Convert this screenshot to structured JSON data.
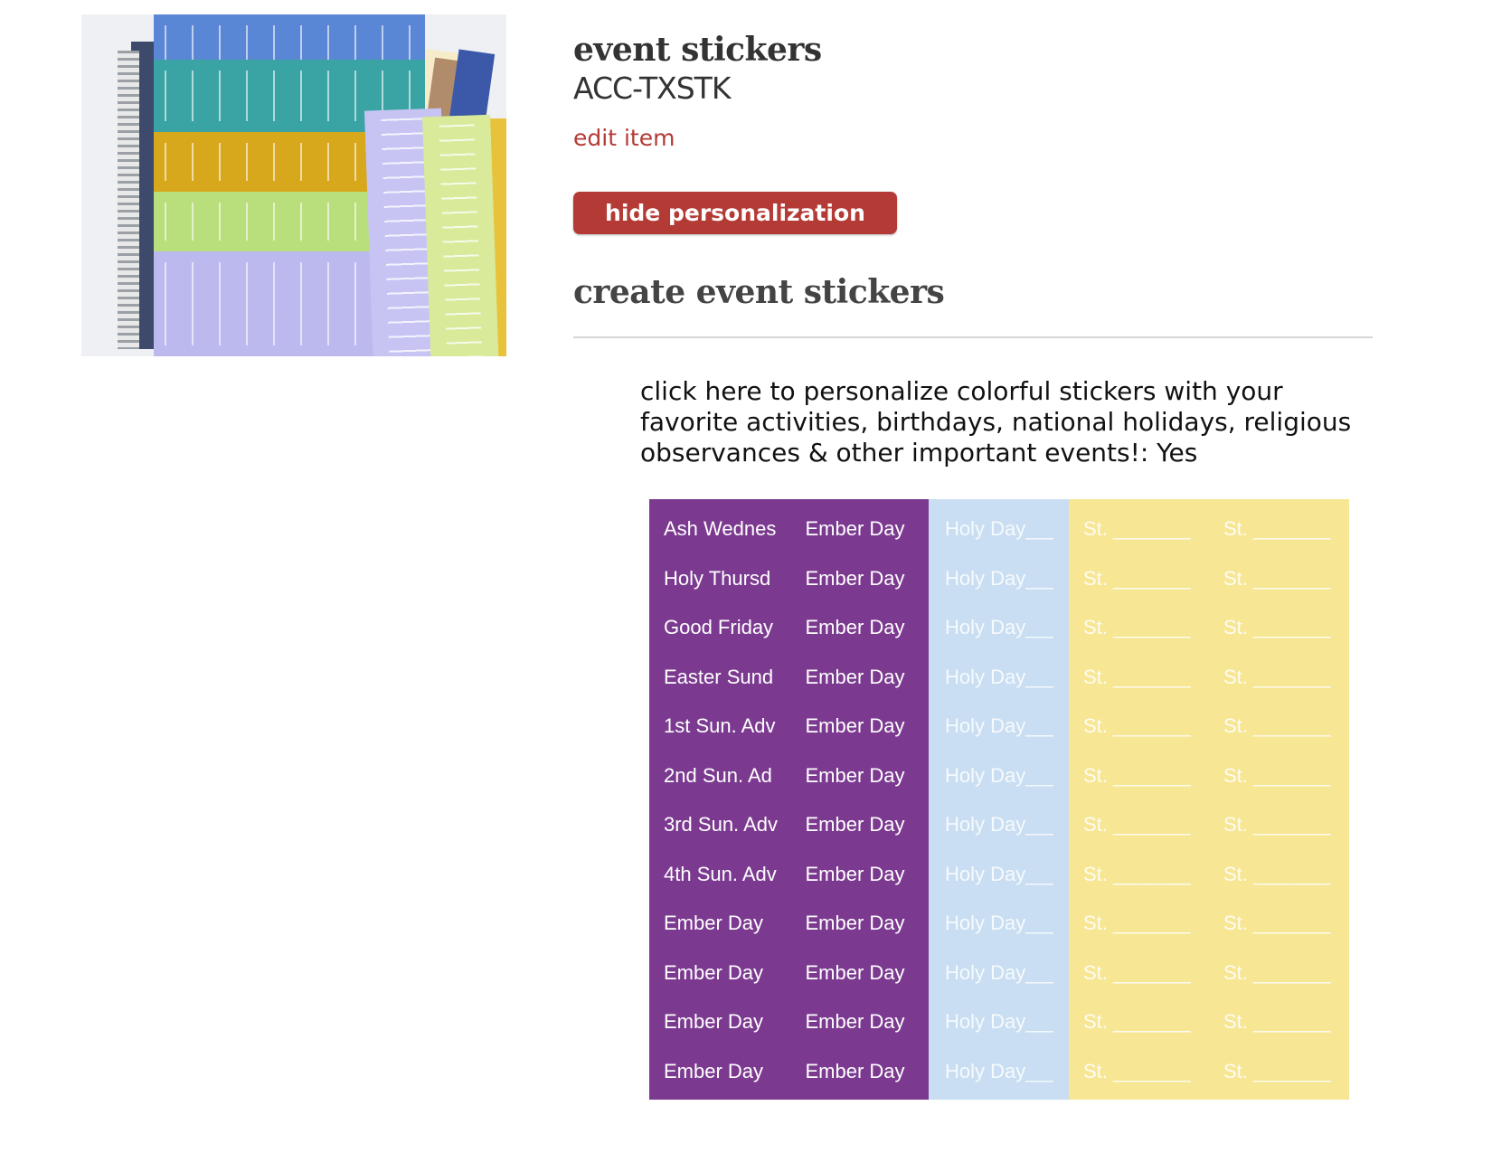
{
  "product": {
    "title": "event stickers",
    "sku": "ACC-TXSTK",
    "edit_label": "edit item",
    "hide_button_label": "hide personalization",
    "section_title": "create event stickers",
    "option_text": "click here to personalize colorful stickers with your favorite activities, birthdays, national holidays, religious observances & other important events!: Yes"
  },
  "colors": {
    "accent": "#b43a35",
    "purple": "#7b3a90",
    "light_blue": "#c9def2",
    "yellow": "#f7e693"
  },
  "stickers": {
    "purple_col1": [
      "Ash Wednes",
      "Holy Thursd",
      "Good Friday",
      "Easter Sund",
      "1st Sun. Adv",
      "2nd Sun. Ad",
      "3rd Sun. Adv",
      "4th Sun. Adv",
      "Ember Day",
      "Ember Day",
      "Ember Day",
      "Ember Day"
    ],
    "purple_col2": [
      "Ember Day",
      "Ember Day",
      "Ember Day",
      "Ember Day",
      "Ember Day",
      "Ember Day",
      "Ember Day",
      "Ember Day",
      "Ember Day",
      "Ember Day",
      "Ember Day",
      "Ember Day"
    ],
    "blue_col": [
      "Holy Day___",
      "Holy Day___",
      "Holy Day___",
      "Holy Day___",
      "Holy Day___",
      "Holy Day___",
      "Holy Day___",
      "Holy Day___",
      "Holy Day___",
      "Holy Day___",
      "Holy Day___",
      "Holy Day___"
    ],
    "yellow_col1": [
      "St. _______",
      "St. _______",
      "St. _______",
      "St. _______",
      "St. _______",
      "St. _______",
      "St. _______",
      "St. _______",
      "St. _______",
      "St. _______",
      "St. _______",
      "St. _______"
    ],
    "yellow_col2": [
      "St. _______",
      "St. _______",
      "St. _______",
      "St. _______",
      "St. _______",
      "St. _______",
      "St. _______",
      "St. _______",
      "St. _______",
      "St. _______",
      "St. _______",
      "St. _______"
    ]
  }
}
